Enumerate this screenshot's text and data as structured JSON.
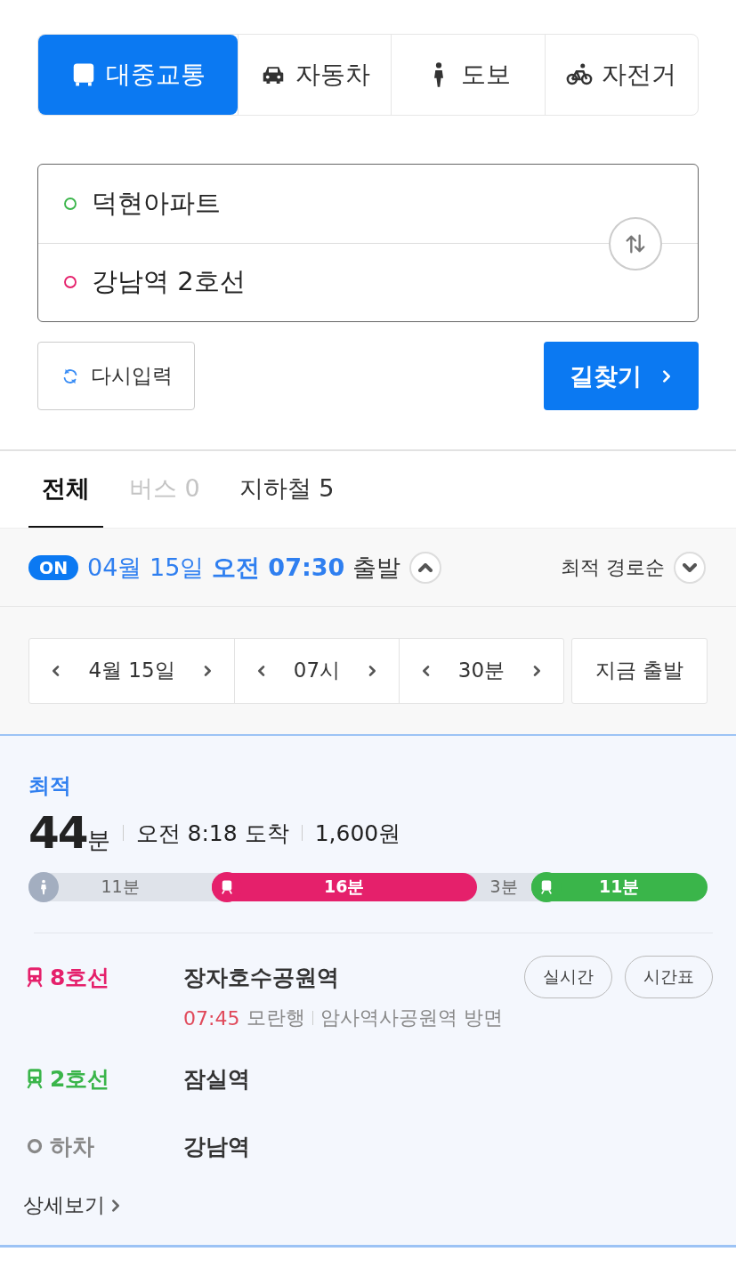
{
  "modes": [
    {
      "kind": "bus",
      "label": "대중교통",
      "selected": true
    },
    {
      "kind": "car",
      "label": "자동차",
      "selected": false
    },
    {
      "kind": "walk",
      "label": "도보",
      "selected": false
    },
    {
      "kind": "bike",
      "label": "자전거",
      "selected": false
    }
  ],
  "route": {
    "origin": "덕현아파트",
    "destination": "강남역 2호선"
  },
  "reset_button": "다시입력",
  "search_button": "길찾기",
  "tabs": [
    {
      "label": "전체",
      "selected": true,
      "disabled": false
    },
    {
      "label": "버스 0",
      "selected": false,
      "disabled": true
    },
    {
      "label": "지하철 5",
      "selected": false,
      "disabled": false
    }
  ],
  "departure": {
    "toggle": "ON",
    "date": "04월 15일",
    "period": "오전",
    "time": "07:30",
    "suffix": "출발",
    "expanded": true,
    "sort": "최적 경로순"
  },
  "pickers": [
    {
      "label": "4월 15일"
    },
    {
      "label": "07시"
    },
    {
      "label": "30분"
    }
  ],
  "now_button": "지금 출발",
  "result": {
    "badge": "최적",
    "minutes": "44",
    "unit": "분",
    "arrival": "오전 8:18 도착",
    "fare": "1,600원",
    "segments": [
      {
        "kind": "walk",
        "label": "11분",
        "color": "#a3aec0"
      },
      {
        "kind": "subway",
        "label": "16분",
        "color": "#e5206b"
      },
      {
        "kind": "transfer",
        "label": "3분"
      },
      {
        "kind": "subway",
        "label": "11분",
        "color": "#3ab54a"
      }
    ],
    "steps": [
      {
        "kind": "board",
        "line": "8호선",
        "color": "#e5206b",
        "station": "장자호수공원역",
        "buttons": [
          "실시간",
          "시간표"
        ],
        "time": "07:45",
        "destination": "모란행",
        "direction": "암사역사공원역 방면"
      },
      {
        "kind": "board",
        "line": "2호선",
        "color": "#3ab54a",
        "station": "잠실역"
      },
      {
        "kind": "alight",
        "line": "하차",
        "color": "#888888",
        "station": "강남역"
      }
    ],
    "detail_link": "상세보기"
  }
}
